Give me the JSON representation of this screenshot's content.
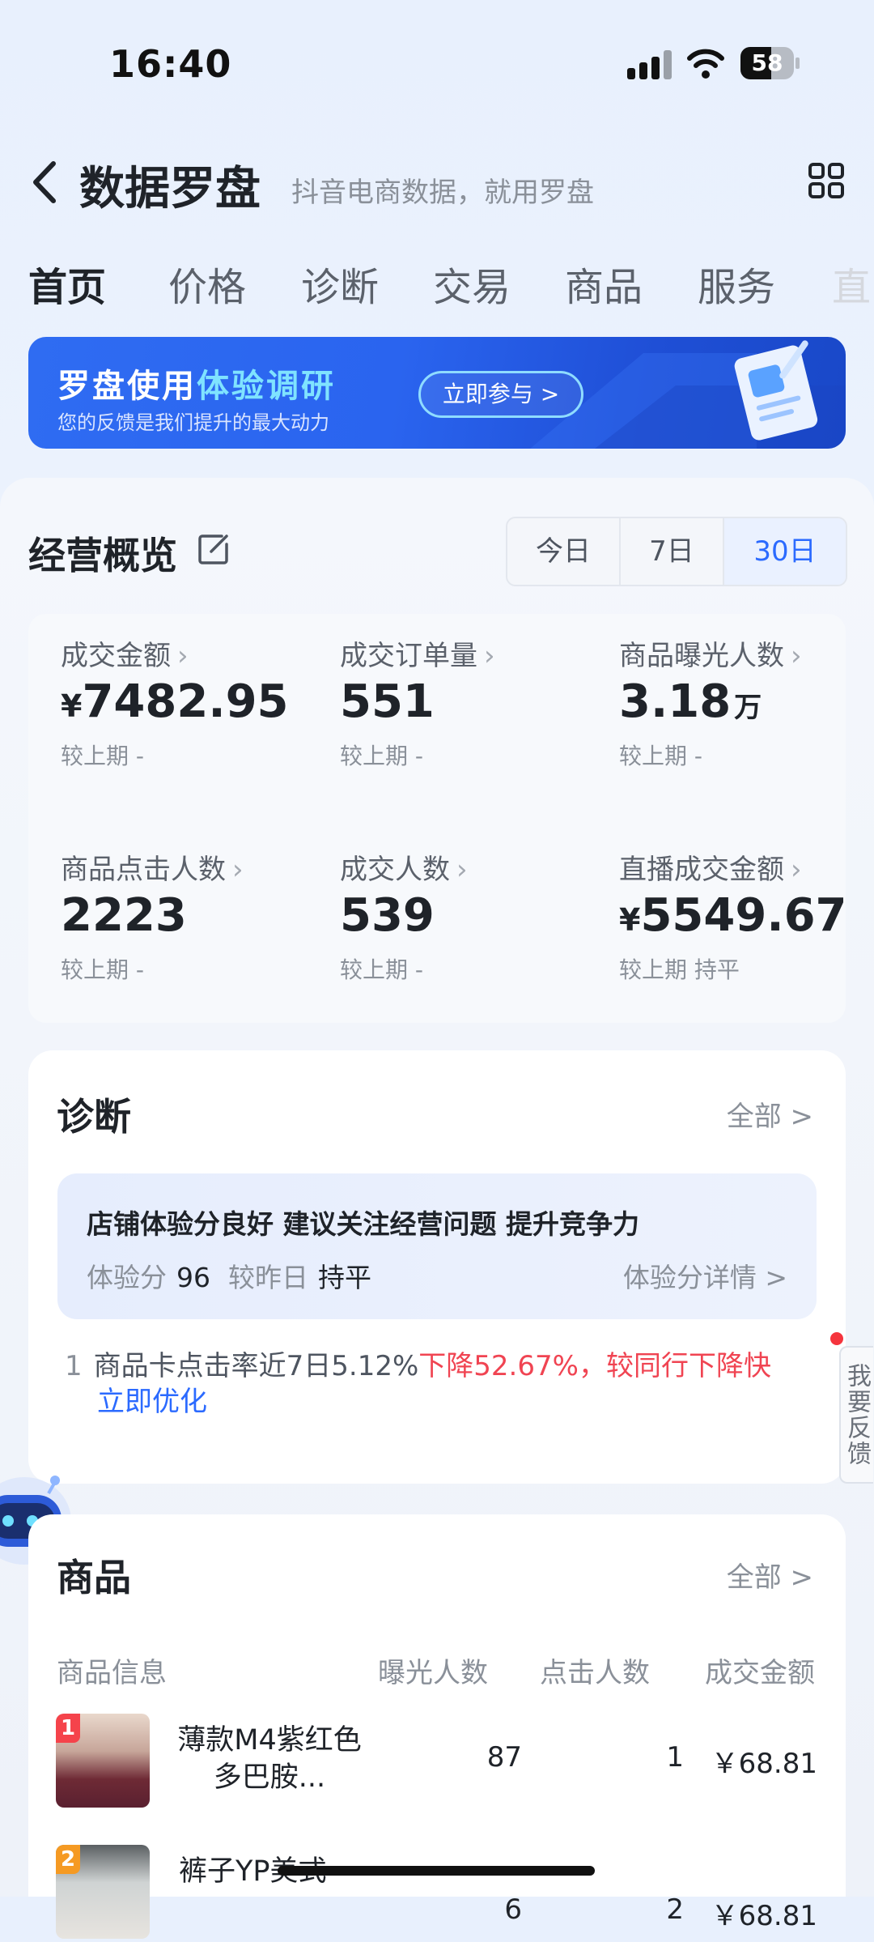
{
  "status": {
    "time": "16:40",
    "battery": "58",
    "battery_level": 0.58
  },
  "header": {
    "title": "数据罗盘",
    "subtitle": "抖音电商数据，就用罗盘"
  },
  "tabs": [
    {
      "label": "首页"
    },
    {
      "label": "价格"
    },
    {
      "label": "诊断"
    },
    {
      "label": "交易"
    },
    {
      "label": "商品"
    },
    {
      "label": "服务"
    },
    {
      "label": "直"
    }
  ],
  "banner": {
    "title_a": "罗盘使用",
    "title_b": "体验调研",
    "subtitle": "您的反馈是我们提升的最大动力",
    "button": "立即参与 >"
  },
  "overview": {
    "title": "经营概览",
    "ranges": [
      "今日",
      "7日",
      "30日"
    ],
    "selected_range": "30日",
    "metrics": [
      {
        "label": "成交金额",
        "prefix": "¥",
        "value": "7482.95",
        "unit": "",
        "compare": "较上期 -"
      },
      {
        "label": "成交订单量",
        "prefix": "",
        "value": "551",
        "unit": "",
        "compare": "较上期 -"
      },
      {
        "label": "商品曝光人数",
        "prefix": "",
        "value": "3.18",
        "unit": "万",
        "compare": "较上期 -"
      },
      {
        "label": "商品点击人数",
        "prefix": "",
        "value": "2223",
        "unit": "",
        "compare": "较上期 -"
      },
      {
        "label": "成交人数",
        "prefix": "",
        "value": "539",
        "unit": "",
        "compare": "较上期 -"
      },
      {
        "label": "直播成交金额",
        "prefix": "¥",
        "value": "5549.67",
        "unit": "",
        "compare": "较上期 持平"
      }
    ]
  },
  "diagnosis": {
    "title": "诊断",
    "more": "全部 >",
    "headline": "店铺体验分良好 建议关注经营问题 提升竞争力",
    "score_label": "体验分",
    "score": "96",
    "vs_label": "较昨日",
    "vs_value": "持平",
    "detail_link": "体验分详情 >",
    "issue": {
      "num": "1",
      "text": "商品卡点击率近7日5.12%",
      "alert": "下降52.67%，较同行下降快",
      "action": "立即优化"
    }
  },
  "feedback": "我要反馈",
  "products": {
    "title": "商品",
    "more": "全部 >",
    "columns": [
      "商品信息",
      "曝光人数",
      "点击人数",
      "成交金额"
    ],
    "rows": [
      {
        "rank": "1",
        "name": "薄款M4紫红色多巴胺...",
        "exposure": "87",
        "clicks": "1",
        "amount": "￥68.81"
      },
      {
        "rank": "2",
        "name": "裤子YP美式",
        "exposure": "6",
        "clicks": "2",
        "amount": "￥68.81"
      }
    ]
  },
  "colors": {
    "accent": "#2b6aff",
    "alert": "#f04452",
    "rank1": "#f5434b",
    "rank2": "#f59a23"
  }
}
